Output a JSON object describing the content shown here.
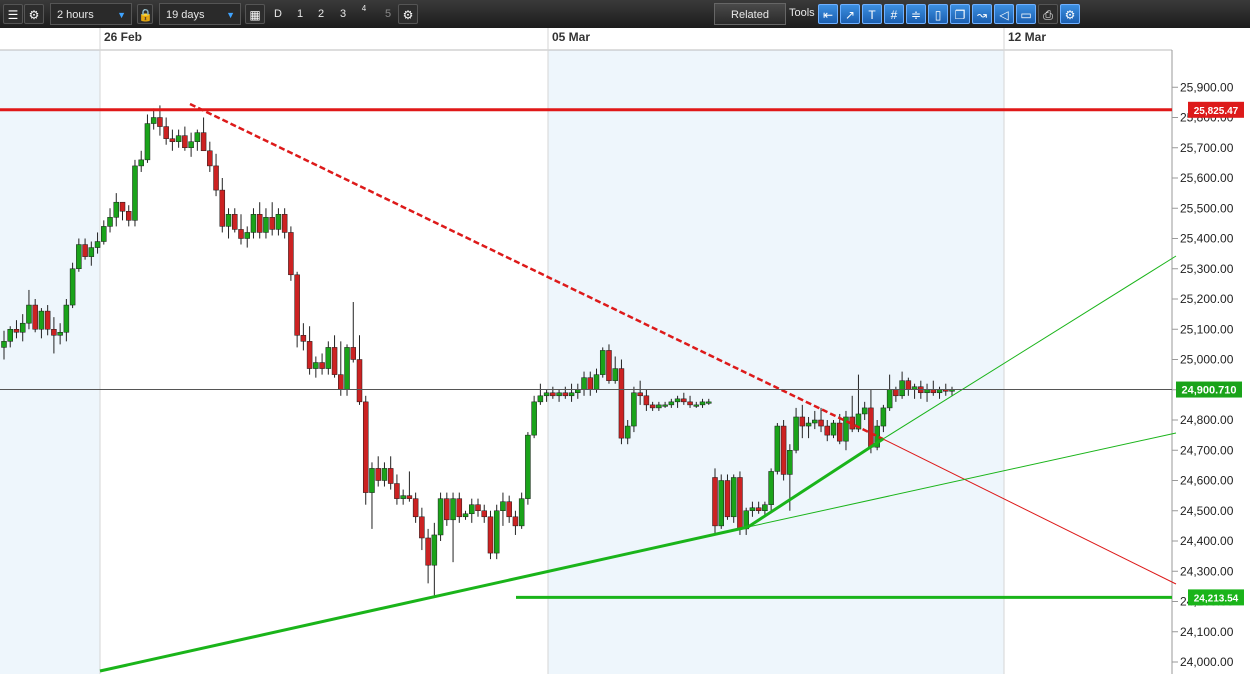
{
  "toolbar": {
    "interval": "2 hours",
    "range": "19 days",
    "period_buttons": [
      "D",
      "1",
      "2",
      "3",
      "4",
      "5"
    ],
    "related_label": "Related",
    "tools_label": "Tools"
  },
  "chart_data": {
    "type": "candlestick",
    "x_labels": [
      "26 Feb",
      "05 Mar",
      "12 Mar"
    ],
    "y_ticks": [
      "25,900.00",
      "25,800.00",
      "25,700.00",
      "25,600.00",
      "25,500.00",
      "25,400.00",
      "25,300.00",
      "25,200.00",
      "25,100.00",
      "25,000.00",
      "24,900.00",
      "24,800.00",
      "24,700.00",
      "24,600.00",
      "24,500.00",
      "24,400.00",
      "24,300.00",
      "24,200.00",
      "24,100.00",
      "24,000.00"
    ],
    "ylim": [
      24000,
      25950
    ],
    "current_price": "24,900.710",
    "resistance_level": "25,825.47",
    "support_level": "24,213.54",
    "colors": {
      "up": "#1aa31a",
      "down": "#cc2222",
      "resistance": "#e01818",
      "support": "#1ab41a",
      "current": "#1aa31a"
    },
    "candles": [
      {
        "o": 25040,
        "h": 25095,
        "l": 25000,
        "c": 25060
      },
      {
        "o": 25060,
        "h": 25110,
        "l": 25040,
        "c": 25100
      },
      {
        "o": 25100,
        "h": 25130,
        "l": 25070,
        "c": 25090
      },
      {
        "o": 25090,
        "h": 25150,
        "l": 25060,
        "c": 25120
      },
      {
        "o": 25120,
        "h": 25230,
        "l": 25100,
        "c": 25180
      },
      {
        "o": 25180,
        "h": 25200,
        "l": 25090,
        "c": 25100
      },
      {
        "o": 25100,
        "h": 25170,
        "l": 25070,
        "c": 25160
      },
      {
        "o": 25160,
        "h": 25180,
        "l": 25080,
        "c": 25100
      },
      {
        "o": 25100,
        "h": 25140,
        "l": 25020,
        "c": 25080
      },
      {
        "o": 25080,
        "h": 25120,
        "l": 25050,
        "c": 25090
      },
      {
        "o": 25090,
        "h": 25200,
        "l": 25060,
        "c": 25180
      },
      {
        "o": 25180,
        "h": 25320,
        "l": 25170,
        "c": 25300
      },
      {
        "o": 25300,
        "h": 25400,
        "l": 25290,
        "c": 25380
      },
      {
        "o": 25380,
        "h": 25400,
        "l": 25330,
        "c": 25340
      },
      {
        "o": 25340,
        "h": 25390,
        "l": 25310,
        "c": 25370
      },
      {
        "o": 25370,
        "h": 25420,
        "l": 25350,
        "c": 25390
      },
      {
        "o": 25390,
        "h": 25460,
        "l": 25380,
        "c": 25440
      },
      {
        "o": 25440,
        "h": 25500,
        "l": 25420,
        "c": 25470
      },
      {
        "o": 25470,
        "h": 25550,
        "l": 25440,
        "c": 25520
      },
      {
        "o": 25520,
        "h": 25520,
        "l": 25460,
        "c": 25490
      },
      {
        "o": 25490,
        "h": 25510,
        "l": 25440,
        "c": 25460
      },
      {
        "o": 25460,
        "h": 25660,
        "l": 25440,
        "c": 25640
      },
      {
        "o": 25640,
        "h": 25690,
        "l": 25620,
        "c": 25660
      },
      {
        "o": 25660,
        "h": 25810,
        "l": 25650,
        "c": 25780
      },
      {
        "o": 25780,
        "h": 25830,
        "l": 25760,
        "c": 25800
      },
      {
        "o": 25800,
        "h": 25840,
        "l": 25740,
        "c": 25770
      },
      {
        "o": 25770,
        "h": 25800,
        "l": 25710,
        "c": 25730
      },
      {
        "o": 25730,
        "h": 25760,
        "l": 25690,
        "c": 25720
      },
      {
        "o": 25720,
        "h": 25760,
        "l": 25700,
        "c": 25740
      },
      {
        "o": 25740,
        "h": 25770,
        "l": 25690,
        "c": 25700
      },
      {
        "o": 25700,
        "h": 25750,
        "l": 25670,
        "c": 25720
      },
      {
        "o": 25720,
        "h": 25760,
        "l": 25690,
        "c": 25750
      },
      {
        "o": 25750,
        "h": 25800,
        "l": 25720,
        "c": 25690
      },
      {
        "o": 25690,
        "h": 25720,
        "l": 25620,
        "c": 25640
      },
      {
        "o": 25640,
        "h": 25680,
        "l": 25540,
        "c": 25560
      },
      {
        "o": 25560,
        "h": 25600,
        "l": 25420,
        "c": 25440
      },
      {
        "o": 25440,
        "h": 25500,
        "l": 25400,
        "c": 25480
      },
      {
        "o": 25480,
        "h": 25500,
        "l": 25420,
        "c": 25430
      },
      {
        "o": 25430,
        "h": 25480,
        "l": 25380,
        "c": 25400
      },
      {
        "o": 25400,
        "h": 25440,
        "l": 25370,
        "c": 25420
      },
      {
        "o": 25420,
        "h": 25500,
        "l": 25400,
        "c": 25480
      },
      {
        "o": 25480,
        "h": 25520,
        "l": 25400,
        "c": 25420
      },
      {
        "o": 25420,
        "h": 25500,
        "l": 25400,
        "c": 25470
      },
      {
        "o": 25470,
        "h": 25520,
        "l": 25410,
        "c": 25430
      },
      {
        "o": 25430,
        "h": 25500,
        "l": 25410,
        "c": 25480
      },
      {
        "o": 25480,
        "h": 25500,
        "l": 25400,
        "c": 25420
      },
      {
        "o": 25420,
        "h": 25440,
        "l": 25260,
        "c": 25280
      },
      {
        "o": 25280,
        "h": 25290,
        "l": 25040,
        "c": 25080
      },
      {
        "o": 25080,
        "h": 25120,
        "l": 25030,
        "c": 25060
      },
      {
        "o": 25060,
        "h": 25110,
        "l": 24950,
        "c": 24970
      },
      {
        "o": 24970,
        "h": 25010,
        "l": 24940,
        "c": 24990
      },
      {
        "o": 24990,
        "h": 25020,
        "l": 24950,
        "c": 24970
      },
      {
        "o": 24970,
        "h": 25060,
        "l": 24950,
        "c": 25040
      },
      {
        "o": 25040,
        "h": 25080,
        "l": 24940,
        "c": 24950
      },
      {
        "o": 24950,
        "h": 25060,
        "l": 24880,
        "c": 24900
      },
      {
        "o": 24900,
        "h": 25050,
        "l": 24880,
        "c": 25040
      },
      {
        "o": 25040,
        "h": 25190,
        "l": 24990,
        "c": 25000
      },
      {
        "o": 25000,
        "h": 25080,
        "l": 24850,
        "c": 24860
      },
      {
        "o": 24860,
        "h": 24880,
        "l": 24520,
        "c": 24560
      },
      {
        "o": 24560,
        "h": 24660,
        "l": 24440,
        "c": 24640
      },
      {
        "o": 24640,
        "h": 24680,
        "l": 24580,
        "c": 24600
      },
      {
        "o": 24600,
        "h": 24660,
        "l": 24580,
        "c": 24640
      },
      {
        "o": 24640,
        "h": 24680,
        "l": 24570,
        "c": 24590
      },
      {
        "o": 24590,
        "h": 24620,
        "l": 24520,
        "c": 24540
      },
      {
        "o": 24540,
        "h": 24570,
        "l": 24520,
        "c": 24550
      },
      {
        "o": 24550,
        "h": 24630,
        "l": 24530,
        "c": 24540
      },
      {
        "o": 24540,
        "h": 24560,
        "l": 24460,
        "c": 24480
      },
      {
        "o": 24480,
        "h": 24510,
        "l": 24370,
        "c": 24410
      },
      {
        "o": 24410,
        "h": 24440,
        "l": 24260,
        "c": 24320
      },
      {
        "o": 24320,
        "h": 24460,
        "l": 24220,
        "c": 24420
      },
      {
        "o": 24420,
        "h": 24560,
        "l": 24400,
        "c": 24540
      },
      {
        "o": 24540,
        "h": 24560,
        "l": 24450,
        "c": 24470
      },
      {
        "o": 24470,
        "h": 24560,
        "l": 24330,
        "c": 24540
      },
      {
        "o": 24540,
        "h": 24560,
        "l": 24460,
        "c": 24480
      },
      {
        "o": 24480,
        "h": 24500,
        "l": 24470,
        "c": 24490
      },
      {
        "o": 24490,
        "h": 24540,
        "l": 24460,
        "c": 24520
      },
      {
        "o": 24520,
        "h": 24540,
        "l": 24480,
        "c": 24500
      },
      {
        "o": 24500,
        "h": 24520,
        "l": 24460,
        "c": 24480
      },
      {
        "o": 24480,
        "h": 24500,
        "l": 24340,
        "c": 24360
      },
      {
        "o": 24360,
        "h": 24520,
        "l": 24340,
        "c": 24500
      },
      {
        "o": 24500,
        "h": 24560,
        "l": 24450,
        "c": 24530
      },
      {
        "o": 24530,
        "h": 24550,
        "l": 24460,
        "c": 24480
      },
      {
        "o": 24480,
        "h": 24500,
        "l": 24420,
        "c": 24450
      },
      {
        "o": 24450,
        "h": 24560,
        "l": 24440,
        "c": 24540
      },
      {
        "o": 24540,
        "h": 24760,
        "l": 24520,
        "c": 24750
      },
      {
        "o": 24750,
        "h": 24880,
        "l": 24740,
        "c": 24860
      },
      {
        "o": 24860,
        "h": 24920,
        "l": 24850,
        "c": 24880
      },
      {
        "o": 24880,
        "h": 24900,
        "l": 24860,
        "c": 24890
      },
      {
        "o": 24890,
        "h": 24910,
        "l": 24870,
        "c": 24880
      },
      {
        "o": 24880,
        "h": 24900,
        "l": 24860,
        "c": 24890
      },
      {
        "o": 24890,
        "h": 24910,
        "l": 24870,
        "c": 24880
      },
      {
        "o": 24880,
        "h": 24920,
        "l": 24860,
        "c": 24890
      },
      {
        "o": 24890,
        "h": 24920,
        "l": 24870,
        "c": 24900
      },
      {
        "o": 24900,
        "h": 24960,
        "l": 24880,
        "c": 24940
      },
      {
        "o": 24940,
        "h": 24960,
        "l": 24880,
        "c": 24900
      },
      {
        "o": 24900,
        "h": 24970,
        "l": 24890,
        "c": 24950
      },
      {
        "o": 24950,
        "h": 25040,
        "l": 24940,
        "c": 25030
      },
      {
        "o": 25030,
        "h": 25050,
        "l": 24920,
        "c": 24930
      },
      {
        "o": 24930,
        "h": 25010,
        "l": 24920,
        "c": 24970
      },
      {
        "o": 24970,
        "h": 25000,
        "l": 24720,
        "c": 24740
      },
      {
        "o": 24740,
        "h": 24800,
        "l": 24720,
        "c": 24780
      },
      {
        "o": 24780,
        "h": 24910,
        "l": 24760,
        "c": 24890
      },
      {
        "o": 24890,
        "h": 24930,
        "l": 24850,
        "c": 24880
      },
      {
        "o": 24880,
        "h": 24900,
        "l": 24830,
        "c": 24850
      },
      {
        "o": 24850,
        "h": 24860,
        "l": 24830,
        "c": 24840
      },
      {
        "o": 24840,
        "h": 24860,
        "l": 24830,
        "c": 24850
      },
      {
        "o": 24850,
        "h": 24860,
        "l": 24840,
        "c": 24850
      },
      {
        "o": 24850,
        "h": 24870,
        "l": 24840,
        "c": 24860
      },
      {
        "o": 24860,
        "h": 24880,
        "l": 24840,
        "c": 24870
      },
      {
        "o": 24870,
        "h": 24890,
        "l": 24850,
        "c": 24860
      },
      {
        "o": 24860,
        "h": 24880,
        "l": 24840,
        "c": 24850
      },
      {
        "o": 24850,
        "h": 24860,
        "l": 24840,
        "c": 24850
      },
      {
        "o": 24850,
        "h": 24870,
        "l": 24840,
        "c": 24860
      },
      {
        "o": 24860,
        "h": 24870,
        "l": 24850,
        "c": 24860
      },
      {
        "o": 24610,
        "h": 24640,
        "l": 24420,
        "c": 24450
      },
      {
        "o": 24450,
        "h": 24620,
        "l": 24440,
        "c": 24600
      },
      {
        "o": 24600,
        "h": 24620,
        "l": 24470,
        "c": 24480
      },
      {
        "o": 24480,
        "h": 24620,
        "l": 24460,
        "c": 24610
      },
      {
        "o": 24610,
        "h": 24630,
        "l": 24420,
        "c": 24440
      },
      {
        "o": 24440,
        "h": 24510,
        "l": 24420,
        "c": 24500
      },
      {
        "o": 24500,
        "h": 24530,
        "l": 24480,
        "c": 24510
      },
      {
        "o": 24510,
        "h": 24530,
        "l": 24490,
        "c": 24500
      },
      {
        "o": 24500,
        "h": 24530,
        "l": 24480,
        "c": 24520
      },
      {
        "o": 24520,
        "h": 24640,
        "l": 24500,
        "c": 24630
      },
      {
        "o": 24630,
        "h": 24790,
        "l": 24620,
        "c": 24780
      },
      {
        "o": 24780,
        "h": 24800,
        "l": 24600,
        "c": 24620
      },
      {
        "o": 24620,
        "h": 24720,
        "l": 24500,
        "c": 24700
      },
      {
        "o": 24700,
        "h": 24840,
        "l": 24690,
        "c": 24810
      },
      {
        "o": 24810,
        "h": 24850,
        "l": 24740,
        "c": 24780
      },
      {
        "o": 24780,
        "h": 24810,
        "l": 24740,
        "c": 24790
      },
      {
        "o": 24790,
        "h": 24830,
        "l": 24770,
        "c": 24800
      },
      {
        "o": 24800,
        "h": 24840,
        "l": 24760,
        "c": 24780
      },
      {
        "o": 24780,
        "h": 24800,
        "l": 24730,
        "c": 24750
      },
      {
        "o": 24750,
        "h": 24800,
        "l": 24740,
        "c": 24790
      },
      {
        "o": 24790,
        "h": 24820,
        "l": 24720,
        "c": 24730
      },
      {
        "o": 24730,
        "h": 24830,
        "l": 24700,
        "c": 24810
      },
      {
        "o": 24810,
        "h": 24880,
        "l": 24760,
        "c": 24770
      },
      {
        "o": 24770,
        "h": 24950,
        "l": 24760,
        "c": 24820
      },
      {
        "o": 24820,
        "h": 24860,
        "l": 24800,
        "c": 24840
      },
      {
        "o": 24840,
        "h": 24900,
        "l": 24690,
        "c": 24710
      },
      {
        "o": 24710,
        "h": 24800,
        "l": 24700,
        "c": 24780
      },
      {
        "o": 24780,
        "h": 24850,
        "l": 24760,
        "c": 24840
      },
      {
        "o": 24840,
        "h": 24950,
        "l": 24830,
        "c": 24900
      },
      {
        "o": 24900,
        "h": 24910,
        "l": 24860,
        "c": 24880
      },
      {
        "o": 24880,
        "h": 24960,
        "l": 24870,
        "c": 24930
      },
      {
        "o": 24930,
        "h": 24940,
        "l": 24880,
        "c": 24900
      },
      {
        "o": 24900,
        "h": 24920,
        "l": 24870,
        "c": 24910
      },
      {
        "o": 24910,
        "h": 24930,
        "l": 24870,
        "c": 24890
      },
      {
        "o": 24890,
        "h": 24920,
        "l": 24860,
        "c": 24900
      },
      {
        "o": 24900,
        "h": 24930,
        "l": 24880,
        "c": 24890
      },
      {
        "o": 24890,
        "h": 24910,
        "l": 24870,
        "c": 24900
      },
      {
        "o": 24900,
        "h": 24920,
        "l": 24880,
        "c": 24895
      },
      {
        "o": 24895,
        "h": 24910,
        "l": 24880,
        "c": 24900
      }
    ]
  }
}
